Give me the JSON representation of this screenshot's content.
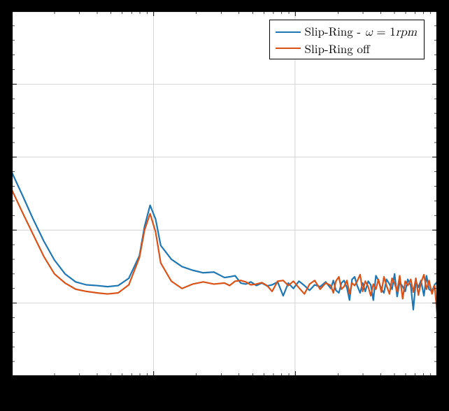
{
  "chart_data": {
    "type": "line",
    "title": "",
    "xlabel": "",
    "ylabel": "",
    "x_scale": "log",
    "grid": true,
    "legend_position": "top-right",
    "xlim_rel": [
      0,
      1
    ],
    "ylim_rel": [
      0,
      1
    ],
    "series": [
      {
        "name": "Slip-Ring - ω = 1rpm",
        "color": "#1f77b4",
        "x_rel": [
          0.0,
          0.025,
          0.05,
          0.075,
          0.1,
          0.125,
          0.15,
          0.175,
          0.2,
          0.225,
          0.25,
          0.275,
          0.3,
          0.312,
          0.325,
          0.338,
          0.35,
          0.375,
          0.4,
          0.425,
          0.45,
          0.475,
          0.5,
          0.512,
          0.525,
          0.538,
          0.55,
          0.562,
          0.575,
          0.588,
          0.6,
          0.612,
          0.625,
          0.638,
          0.65,
          0.662,
          0.675,
          0.688,
          0.7,
          0.712,
          0.725,
          0.738,
          0.75,
          0.756,
          0.762,
          0.769,
          0.775,
          0.781,
          0.788,
          0.794,
          0.8,
          0.806,
          0.812,
          0.819,
          0.825,
          0.831,
          0.838,
          0.844,
          0.85,
          0.856,
          0.862,
          0.869,
          0.875,
          0.881,
          0.888,
          0.894,
          0.9,
          0.906,
          0.912,
          0.919,
          0.925,
          0.931,
          0.938,
          0.944,
          0.95,
          0.956,
          0.962,
          0.969,
          0.975,
          0.981,
          0.988,
          0.994,
          1.0
        ],
        "y_rel": [
          0.558,
          0.495,
          0.43,
          0.37,
          0.318,
          0.28,
          0.258,
          0.25,
          0.248,
          0.245,
          0.248,
          0.268,
          0.33,
          0.41,
          0.468,
          0.43,
          0.358,
          0.32,
          0.3,
          0.29,
          0.283,
          0.285,
          0.27,
          0.272,
          0.275,
          0.255,
          0.252,
          0.258,
          0.248,
          0.255,
          0.247,
          0.25,
          0.258,
          0.22,
          0.255,
          0.24,
          0.26,
          0.248,
          0.235,
          0.25,
          0.245,
          0.258,
          0.24,
          0.262,
          0.235,
          0.228,
          0.255,
          0.262,
          0.242,
          0.208,
          0.265,
          0.272,
          0.248,
          0.228,
          0.255,
          0.232,
          0.26,
          0.25,
          0.208,
          0.275,
          0.262,
          0.238,
          0.228,
          0.265,
          0.252,
          0.238,
          0.28,
          0.218,
          0.258,
          0.245,
          0.232,
          0.265,
          0.248,
          0.182,
          0.26,
          0.243,
          0.262,
          0.22,
          0.275,
          0.238,
          0.232,
          0.25,
          0.258
        ]
      },
      {
        "name": "Slip-Ring off",
        "color": "#d95319",
        "x_rel": [
          0.0,
          0.025,
          0.05,
          0.075,
          0.1,
          0.125,
          0.15,
          0.175,
          0.2,
          0.225,
          0.25,
          0.275,
          0.3,
          0.312,
          0.325,
          0.338,
          0.35,
          0.375,
          0.4,
          0.425,
          0.45,
          0.475,
          0.5,
          0.512,
          0.525,
          0.538,
          0.55,
          0.562,
          0.575,
          0.588,
          0.6,
          0.612,
          0.625,
          0.638,
          0.65,
          0.662,
          0.675,
          0.688,
          0.7,
          0.712,
          0.725,
          0.738,
          0.75,
          0.756,
          0.762,
          0.769,
          0.775,
          0.781,
          0.788,
          0.794,
          0.8,
          0.806,
          0.812,
          0.819,
          0.825,
          0.831,
          0.838,
          0.844,
          0.85,
          0.856,
          0.862,
          0.869,
          0.875,
          0.881,
          0.888,
          0.894,
          0.9,
          0.906,
          0.912,
          0.919,
          0.925,
          0.931,
          0.938,
          0.944,
          0.95,
          0.956,
          0.962,
          0.969,
          0.975,
          0.981,
          0.988,
          0.994,
          1.0
        ],
        "y_rel": [
          0.51,
          0.448,
          0.388,
          0.328,
          0.28,
          0.255,
          0.238,
          0.232,
          0.228,
          0.225,
          0.228,
          0.25,
          0.325,
          0.4,
          0.445,
          0.395,
          0.31,
          0.26,
          0.24,
          0.252,
          0.258,
          0.252,
          0.255,
          0.248,
          0.26,
          0.262,
          0.258,
          0.25,
          0.252,
          0.256,
          0.248,
          0.232,
          0.26,
          0.262,
          0.248,
          0.26,
          0.242,
          0.225,
          0.252,
          0.262,
          0.238,
          0.255,
          0.248,
          0.228,
          0.26,
          0.272,
          0.238,
          0.245,
          0.262,
          0.225,
          0.255,
          0.248,
          0.26,
          0.278,
          0.232,
          0.26,
          0.245,
          0.22,
          0.252,
          0.238,
          0.265,
          0.23,
          0.272,
          0.248,
          0.225,
          0.268,
          0.254,
          0.232,
          0.275,
          0.212,
          0.26,
          0.248,
          0.265,
          0.23,
          0.268,
          0.222,
          0.256,
          0.278,
          0.238,
          0.262,
          0.225,
          0.248,
          0.172
        ]
      }
    ],
    "grid_x_rel": [
      0.333,
      0.666
    ],
    "grid_y_rel": [
      0.2,
      0.4,
      0.6,
      0.8
    ]
  },
  "legend": {
    "items": [
      {
        "swatch_color": "#1f77b4",
        "label_html": "Slip-Ring - <i>ω</i> = 1<i>rpm</i>"
      },
      {
        "swatch_color": "#d95319",
        "label_html": "Slip-Ring off"
      }
    ]
  },
  "tick_marks": {
    "bottom_log_pattern": true,
    "left_count": 5
  }
}
